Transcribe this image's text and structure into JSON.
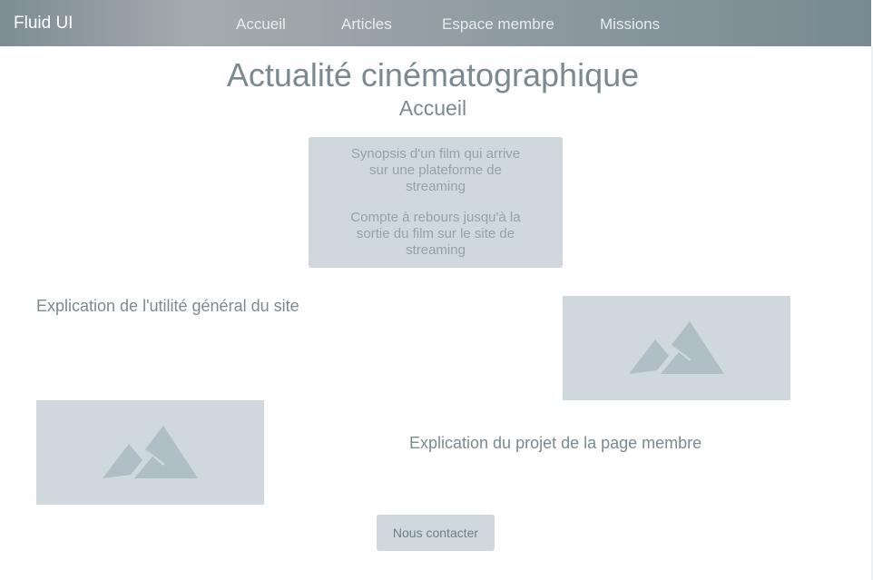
{
  "navbar": {
    "brand": "Fluid UI",
    "items": [
      {
        "label": "Accueil"
      },
      {
        "label": "Articles"
      },
      {
        "label": "Espace membre"
      },
      {
        "label": "Missions"
      }
    ]
  },
  "header": {
    "title": "Actualité cinématographique",
    "subtitle": "Accueil"
  },
  "hero": {
    "synopsis": "Synopsis d'un film qui arrive sur une plateforme de streaming",
    "countdown": "Compte à rebours jusqu'à la sortie du film sur le site de streaming"
  },
  "sections": {
    "site_purpose": "Explication de l'utilité général du site",
    "member_project": "Explication du projet de la page membre"
  },
  "images": {
    "icon": "image-placeholder-icon"
  },
  "contact_button": {
    "label": "Nous contacter"
  },
  "colors": {
    "navbar_gradient_start": "#7d8c93",
    "navbar_gradient_mid": "#a4abae",
    "navbar_gradient_end": "#778a91",
    "placeholder": "#cfd8dc",
    "placeholder_icon": "#b0bec5",
    "text": "#7a8a90"
  }
}
